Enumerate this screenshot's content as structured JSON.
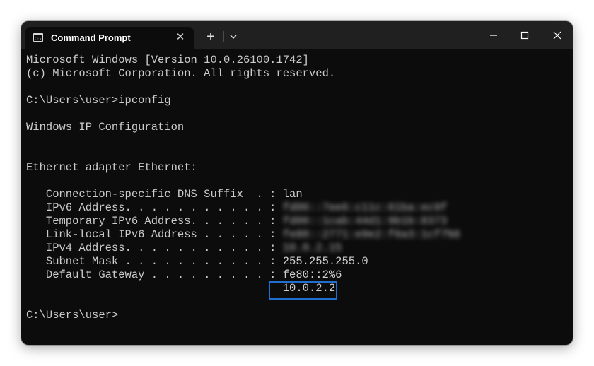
{
  "window": {
    "tab_title": "Command Prompt",
    "tab_close": "✕",
    "new_tab": "+",
    "window_controls": {
      "minimize_icon": "minimize-icon",
      "maximize_icon": "maximize-icon",
      "close_icon": "close-icon"
    }
  },
  "terminal": {
    "lines": {
      "version": "Microsoft Windows [Version 10.0.26100.1742]",
      "copyright": "(c) Microsoft Corporation. All rights reserved.",
      "prompt1": "C:\\Users\\user>ipconfig",
      "ipconfig_header": "Windows IP Configuration",
      "adapter": "Ethernet adapter Ethernet:",
      "dns_suffix": "   Connection-specific DNS Suffix  . : lan",
      "ipv6_label": "   IPv6 Address. . . . . . . . . . . : ",
      "ipv6_value": "fd00::7ee6:c11c:61ba:ec9f",
      "temp_ipv6_label": "   Temporary IPv6 Address. . . . . . : ",
      "temp_ipv6_value": "fd00::1cab:44d1:9b1b:8373",
      "link_local_label": "   Link-local IPv6 Address . . . . . : ",
      "link_local_value": "fe80::2771:e9e2:f6a3:1cf7%6",
      "ipv4_label": "   IPv4 Address. . . . . . . . . . . : ",
      "ipv4_value": "10.0.2.15",
      "subnet": "   Subnet Mask . . . . . . . . . . . : 255.255.255.0",
      "gateway": "   Default Gateway . . . . . . . . . : fe80::2%6",
      "gateway_ipv4": "                                       10.0.2.2",
      "prompt2": "C:\\Users\\user>"
    }
  },
  "colors": {
    "terminal_bg": "#0c0c0c",
    "titlebar_bg": "#202020",
    "terminal_text": "#cccccc",
    "highlight_border": "#1f6fd1"
  }
}
